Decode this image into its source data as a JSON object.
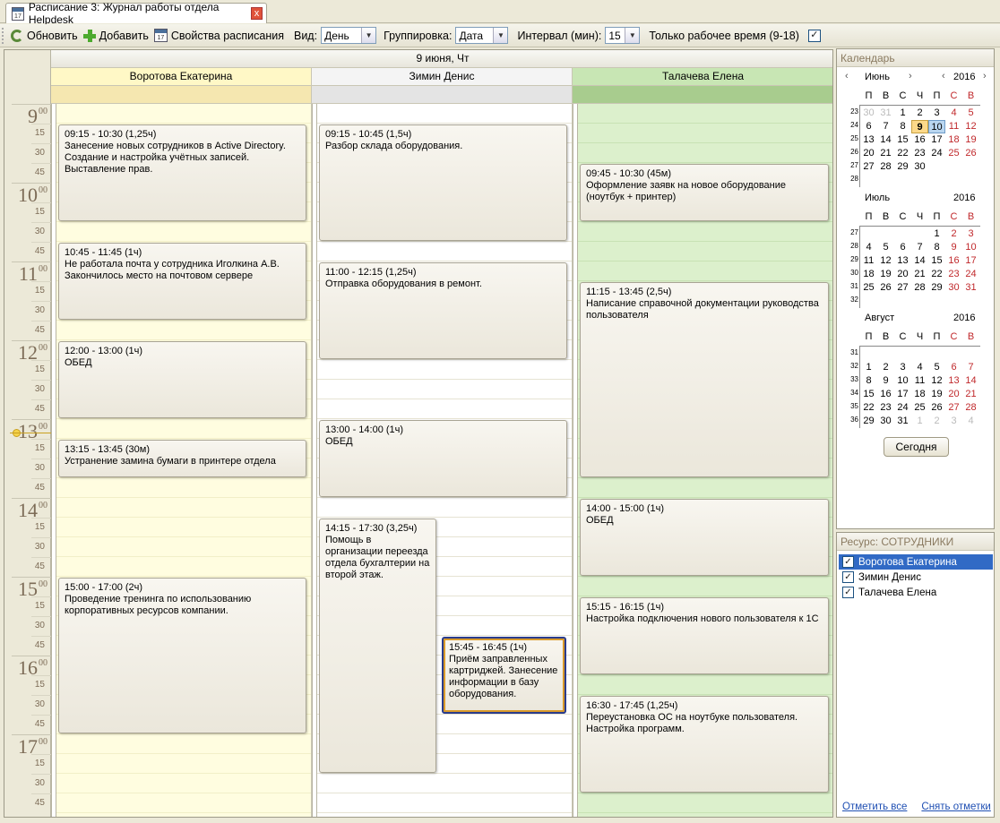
{
  "tab": {
    "title": "Расписание 3: Журнал работы отдела Helpdesk",
    "close": "x"
  },
  "toolbar": {
    "refresh": "Обновить",
    "add": "Добавить",
    "props": "Свойства расписания",
    "view_label": "Вид:",
    "view_value": "День",
    "group_label": "Группировка:",
    "group_value": "Дата",
    "interval_label": "Интервал (мин):",
    "interval_value": "15",
    "worktime_label": "Только рабочее время (9-18)",
    "worktime_checked": true
  },
  "schedule": {
    "date": "9 июня, Чт",
    "resources": [
      {
        "name": "Воротова Екатерина",
        "color": "#fffde0",
        "header": "#fff8c6",
        "sub": "#f5e7b0"
      },
      {
        "name": "Зимин Денис",
        "color": "#ffffff",
        "header": "#f4f4f4",
        "sub": "#e4e4e4"
      },
      {
        "name": "Талачева Елена",
        "color": "#dcf0cc",
        "header": "#c8e6b4",
        "sub": "#a8cc8e"
      }
    ],
    "hours": [
      "9",
      "10",
      "11",
      "12",
      "13",
      "14",
      "15",
      "16",
      "17"
    ],
    "hour_sup": "00",
    "minutes": [
      "15",
      "30",
      "45"
    ],
    "events": [
      {
        "res": 0,
        "start": 9.25,
        "end": 10.5,
        "time": "09:15 - 10:30 (1,25ч)",
        "text": "Занесение новых сотрудников в Active Directory. Создание и настройка учётных записей. Выставление прав."
      },
      {
        "res": 0,
        "start": 10.75,
        "end": 11.75,
        "time": "10:45 - 11:45 (1ч)",
        "text": "Не работала почта у сотрудника Иголкина А.В. Закончилось место на почтовом сервере"
      },
      {
        "res": 0,
        "start": 12,
        "end": 13,
        "time": "12:00 - 13:00 (1ч)",
        "text": "ОБЕД"
      },
      {
        "res": 0,
        "start": 13.25,
        "end": 13.75,
        "time": "13:15 - 13:45 (30м)",
        "text": "Устранение замина бумаги в принтере отдела"
      },
      {
        "res": 0,
        "start": 15,
        "end": 17,
        "time": "15:00 - 17:00 (2ч)",
        "text": "Проведение тренинга по использованию корпоративных ресурсов компании."
      },
      {
        "res": 1,
        "start": 9.25,
        "end": 10.75,
        "time": "09:15 - 10:45 (1,5ч)",
        "text": "Разбор склада оборудования."
      },
      {
        "res": 1,
        "start": 11,
        "end": 12.25,
        "time": "11:00 - 12:15 (1,25ч)",
        "text": "Отправка оборудования в ремонт."
      },
      {
        "res": 1,
        "start": 13,
        "end": 14,
        "time": "13:00 - 14:00 (1ч)",
        "text": "ОБЕД"
      },
      {
        "res": 1,
        "start": 14.25,
        "end": 17.5,
        "time": "14:15 - 17:30 (3,25ч)",
        "text": "Помощь в организации переезда отдела бухгалтерии на второй этаж.",
        "half": "left"
      },
      {
        "res": 1,
        "start": 15.75,
        "end": 16.75,
        "time": "15:45 - 16:45 (1ч)",
        "text": "Приём заправленных картриджей. Занесение информации в базу оборудования.",
        "half": "right",
        "selected": true
      },
      {
        "res": 2,
        "start": 9.75,
        "end": 10.5,
        "time": "09:45 - 10:30 (45м)",
        "text": "Оформление заявк на новое оборудование (ноутбук + принтер)"
      },
      {
        "res": 2,
        "start": 11.25,
        "end": 13.75,
        "time": "11:15 - 13:45 (2,5ч)",
        "text": "Написание справочной документации руководства пользователя"
      },
      {
        "res": 2,
        "start": 14,
        "end": 15,
        "time": "14:00 - 15:00 (1ч)",
        "text": "ОБЕД"
      },
      {
        "res": 2,
        "start": 15.25,
        "end": 16.25,
        "time": "15:15 - 16:15 (1ч)",
        "text": "Настройка подключения нового пользователя к 1С"
      },
      {
        "res": 2,
        "start": 16.5,
        "end": 17.75,
        "time": "16:30 - 17:45 (1,25ч)",
        "text": "Переустановка ОС на ноутбуке пользователя. Настройка программ."
      }
    ]
  },
  "calendar": {
    "title": "Календарь",
    "dow": [
      "П",
      "В",
      "С",
      "Ч",
      "П",
      "С",
      "В"
    ],
    "today_button": "Сегодня",
    "months": [
      {
        "name": "Июнь",
        "year": "2016",
        "nav": true,
        "weeks": [
          [
            "23",
            [
              "30",
              "31",
              "1",
              "2",
              "3",
              "4",
              "5"
            ]
          ],
          [
            "24",
            [
              "6",
              "7",
              "8",
              "9",
              "10",
              "11",
              "12"
            ]
          ],
          [
            "25",
            [
              "13",
              "14",
              "15",
              "16",
              "17",
              "18",
              "19"
            ]
          ],
          [
            "26",
            [
              "20",
              "21",
              "22",
              "23",
              "24",
              "25",
              "26"
            ]
          ],
          [
            "27",
            [
              "27",
              "28",
              "29",
              "30",
              "",
              "",
              ""
            ]
          ],
          [
            "28",
            [
              "",
              "",
              "",
              "",
              "",
              "",
              ""
            ]
          ]
        ]
      },
      {
        "name": "Июль",
        "year": "2016",
        "weeks": [
          [
            "27",
            [
              "",
              "",
              "",
              "",
              "1",
              "2",
              "3"
            ]
          ],
          [
            "28",
            [
              "4",
              "5",
              "6",
              "7",
              "8",
              "9",
              "10"
            ]
          ],
          [
            "29",
            [
              "11",
              "12",
              "13",
              "14",
              "15",
              "16",
              "17"
            ]
          ],
          [
            "30",
            [
              "18",
              "19",
              "20",
              "21",
              "22",
              "23",
              "24"
            ]
          ],
          [
            "31",
            [
              "25",
              "26",
              "27",
              "28",
              "29",
              "30",
              "31"
            ]
          ],
          [
            "32",
            [
              "",
              "",
              "",
              "",
              "",
              "",
              ""
            ]
          ]
        ]
      },
      {
        "name": "Август",
        "year": "2016",
        "weeks": [
          [
            "31",
            [
              "",
              "",
              "",
              "",
              "",
              "",
              ""
            ]
          ],
          [
            "32",
            [
              "1",
              "2",
              "3",
              "4",
              "5",
              "6",
              "7"
            ]
          ],
          [
            "33",
            [
              "8",
              "9",
              "10",
              "11",
              "12",
              "13",
              "14"
            ]
          ],
          [
            "34",
            [
              "15",
              "16",
              "17",
              "18",
              "19",
              "20",
              "21"
            ]
          ],
          [
            "35",
            [
              "22",
              "23",
              "24",
              "25",
              "26",
              "27",
              "28"
            ]
          ],
          [
            "36",
            [
              "29",
              "30",
              "31",
              "1",
              "2",
              "3",
              "4"
            ]
          ]
        ]
      }
    ]
  },
  "resources_panel": {
    "title": "Ресурс: СОТРУДНИКИ",
    "items": [
      "Воротова Екатерина",
      "Зимин Денис",
      "Талачева Елена"
    ],
    "check_all": "Отметить все",
    "uncheck_all": "Снять отметки"
  }
}
